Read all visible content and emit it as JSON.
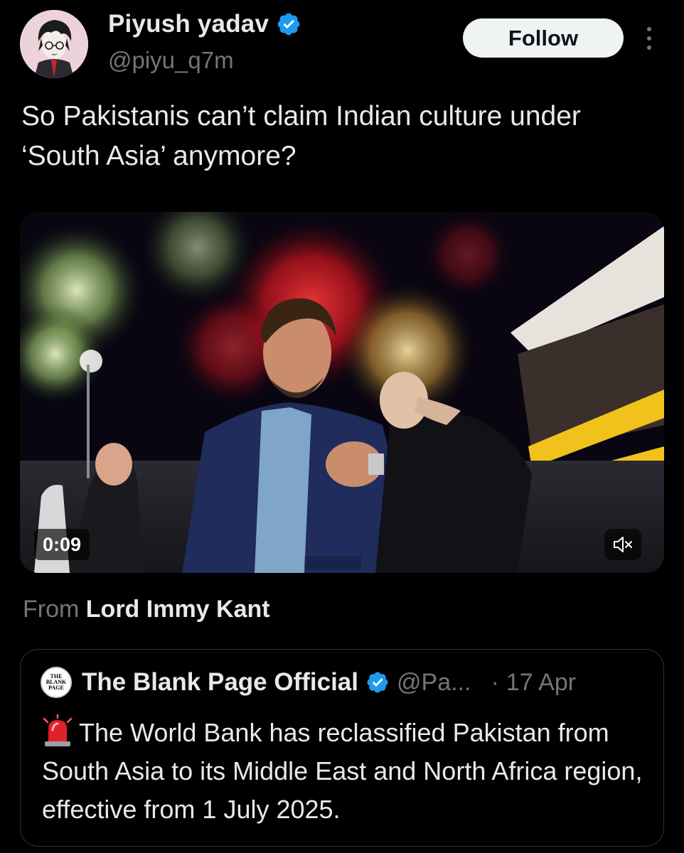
{
  "author": {
    "display_name": "Piyush yadav",
    "handle": "@piyu_q7m",
    "verified_icon": "verified-badge-icon",
    "avatar_icon": "anime-avatar"
  },
  "actions": {
    "follow_label": "Follow",
    "more_icon": "more-vertical-icon"
  },
  "tweet": {
    "text": "So Pakistanis can’t claim Indian culture under ‘South Asia’ anymore?"
  },
  "media": {
    "duration": "0:09",
    "mute_icon": "speaker-muted-icon",
    "type": "video"
  },
  "source": {
    "prefix": "From",
    "name": "Lord Immy Kant"
  },
  "quoted_tweet": {
    "display_name": "The Blank Page Official",
    "handle": "@Pa...",
    "separator": "·",
    "date": "17 Apr",
    "avatar_text": [
      "THE",
      "BLANK",
      "PAGE"
    ],
    "text": "The World Bank has reclassified Pakistan from South Asia to its Middle East and North Africa region, effective from 1 July 2025.",
    "leading_icon": "siren-icon"
  },
  "colors": {
    "background": "#000000",
    "primary_text": "#e7e9ea",
    "secondary_text": "#71767b",
    "verified_blue": "#1d9bf0",
    "border": "#2f3336"
  }
}
